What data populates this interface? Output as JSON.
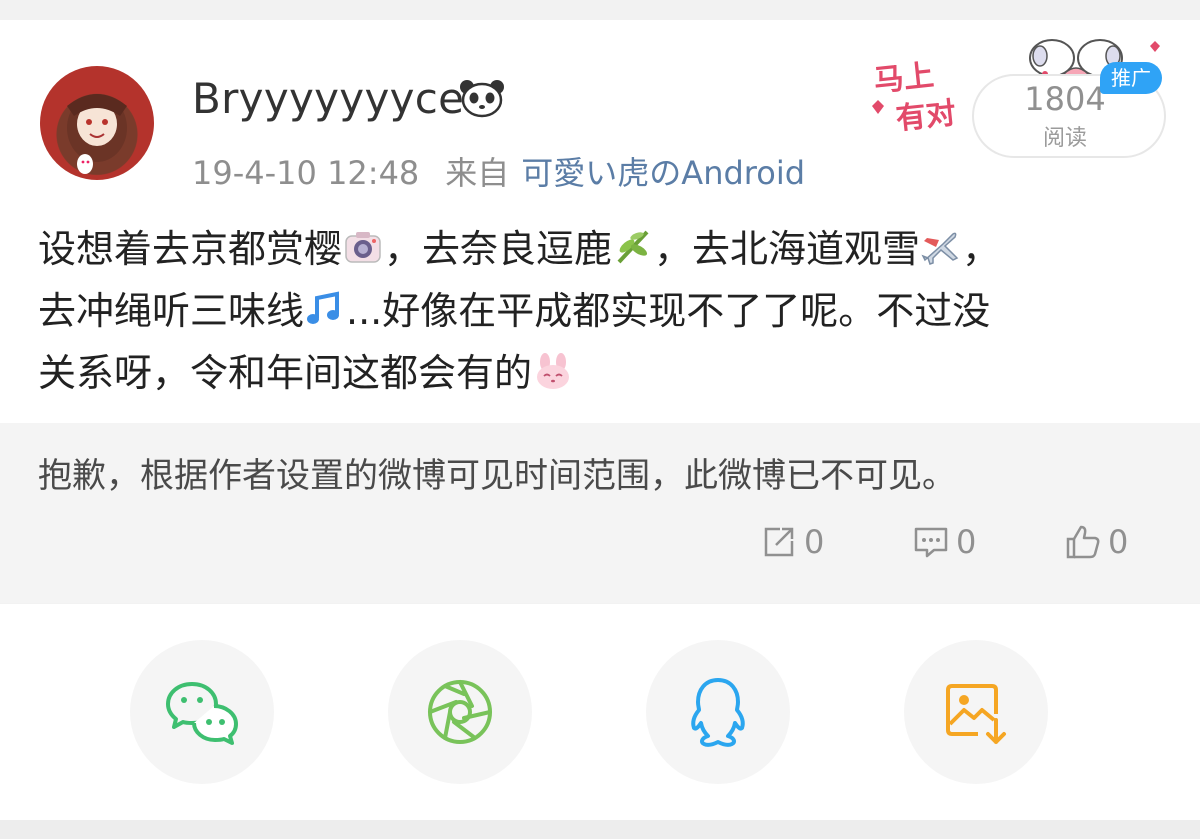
{
  "post": {
    "username": "Bryyyyyyyce",
    "timestamp": "19-4-10 12:48",
    "from_label": "来自",
    "source": "可愛い虎のAndroid",
    "read_count": "1804",
    "read_label": "阅读",
    "ad_badge": "推广",
    "text_parts": [
      "设想着去京都赏樱",
      "，去奈良逗鹿",
      "，去北海道观雪",
      "，",
      "去冲绳听三味线",
      "...好像在平成都实现不了了呢。不过没",
      "关系呀，令和年间这都会有的"
    ],
    "emoji_icons": [
      "camera-icon",
      "bamboo-icon",
      "airplane-icon",
      "music-note-icon",
      "bunny-icon"
    ],
    "user_badge_icon": "panda-icon",
    "promo_icon": "promo-sticker-icon"
  },
  "repost": {
    "notice": "抱歉，根据作者设置的微博可见时间范围，此微博已不可见。",
    "repost_count": "0",
    "comment_count": "0",
    "like_count": "0"
  },
  "share": {
    "buttons": [
      {
        "icon": "wechat-icon",
        "color": "#3ebf70"
      },
      {
        "icon": "moments-icon",
        "color": "#79c35a"
      },
      {
        "icon": "qq-icon",
        "color": "#2ba6ef"
      },
      {
        "icon": "save-image-icon",
        "color": "#f5a623"
      }
    ]
  },
  "colors": {
    "link": "#5b7da6",
    "meta": "#8e8e8e",
    "ad_badge": "#2fa3f6",
    "background": "#f2f2f2"
  }
}
